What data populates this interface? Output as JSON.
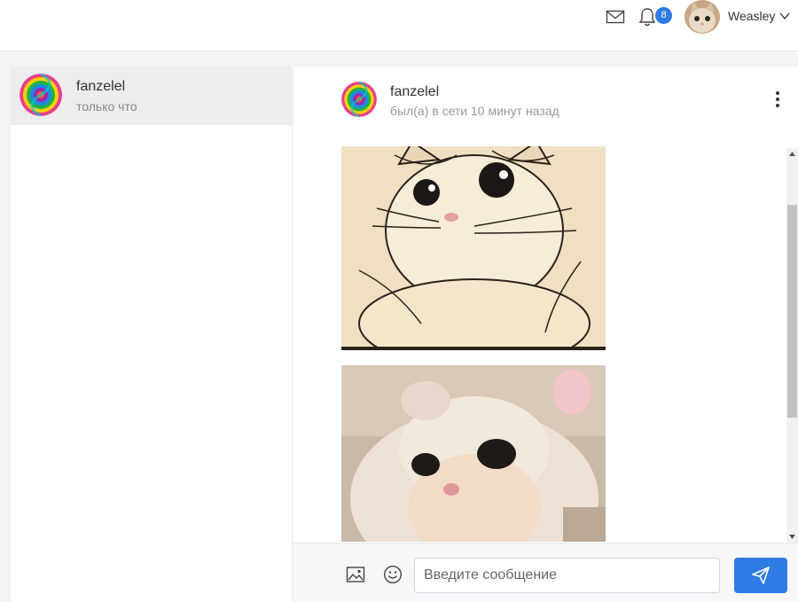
{
  "topbar": {
    "notifications_count": "8",
    "username": "Weasley",
    "icons": [
      "mail-icon",
      "bell-icon",
      "chevron-down-icon"
    ]
  },
  "dialogs": [
    {
      "name": "fanzelel",
      "time": "только что"
    }
  ],
  "chat": {
    "name": "fanzelel",
    "status": "был(а) в сети 10 минут назад",
    "messages": [
      {
        "type": "image",
        "description": "cat photo posterized"
      },
      {
        "type": "image",
        "description": "cat photo pixelated"
      }
    ]
  },
  "composer": {
    "placeholder": "Введите сообщение",
    "value": ""
  },
  "colors": {
    "accent": "#2f7be5",
    "selected_dialog_bg": "#ededf0",
    "background": "#f2f3f5"
  }
}
